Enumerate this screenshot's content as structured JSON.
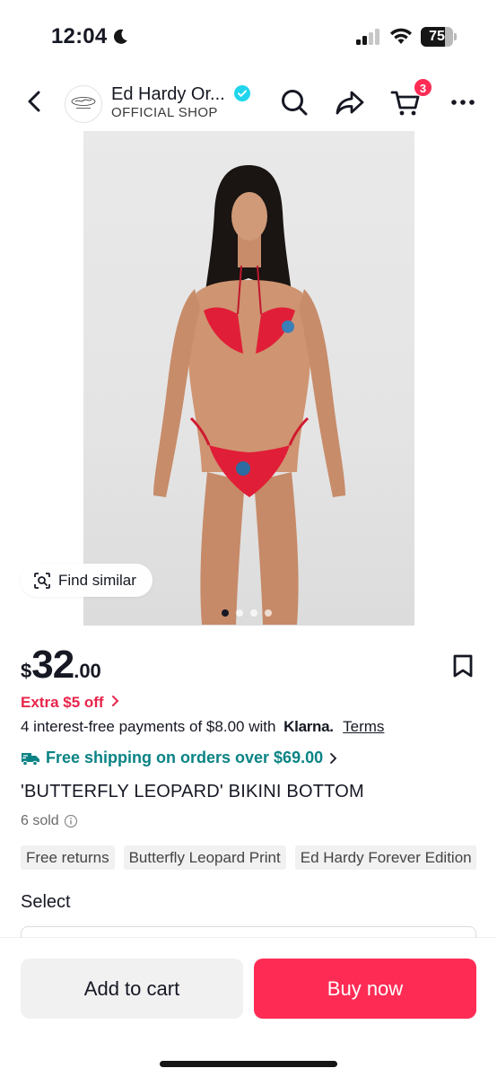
{
  "status_bar": {
    "time": "12:04",
    "battery": "75",
    "battery_level": 0.75
  },
  "header": {
    "shop_name": "Ed Hardy Or...",
    "shop_subtitle": "OFFICIAL SHOP",
    "cart_count": "3",
    "icons": [
      "back-icon",
      "verified-icon",
      "search-icon",
      "share-icon",
      "cart-icon",
      "more-icon"
    ]
  },
  "gallery": {
    "find_similar_label": "Find similar",
    "image_count": 4,
    "active_index": 0
  },
  "product": {
    "price_currency": "$",
    "price_integer": "32",
    "price_decimal": ".00",
    "extra_off": "Extra $5 off",
    "installments_text": "4 interest-free payments of $8.00 with",
    "klarna_label": "Klarna.",
    "terms_label": "Terms",
    "shipping_text": "Free shipping on orders over $69.00",
    "title": "'BUTTERFLY LEOPARD' BIKINI BOTTOM",
    "sold": "6 sold",
    "tags": [
      "Free returns",
      "Butterfly Leopard Print",
      "Ed Hardy Forever Edition"
    ]
  },
  "select": {
    "label": "Select"
  },
  "actions": {
    "add_to_cart": "Add to cart",
    "buy_now": "Buy now"
  },
  "colors": {
    "accent": "#fe2c55",
    "promo": "#e8254b",
    "shipping": "#0b8385",
    "verified": "#20d5ec"
  }
}
